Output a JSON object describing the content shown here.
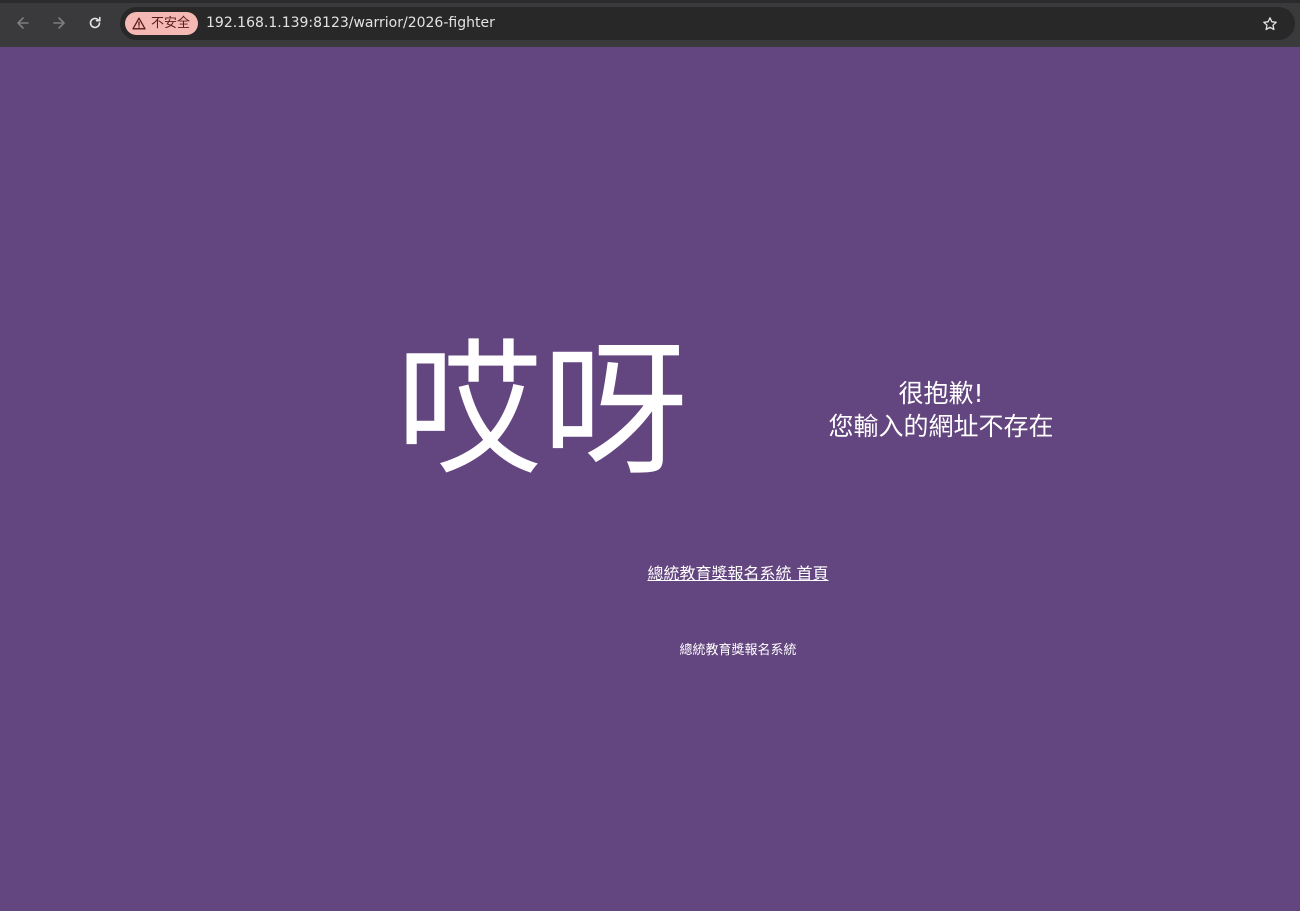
{
  "browser": {
    "security_label": "不安全",
    "url": "192.168.1.139:8123/warrior/2026-fighter",
    "icons": {
      "back": "back-arrow-icon",
      "forward": "forward-arrow-icon",
      "reload": "reload-icon",
      "warning": "warning-triangle-icon",
      "bookmark": "star-icon"
    },
    "colors": {
      "toolbar": "#3a3a3c",
      "omnibox": "#282828",
      "security_chip": "#f4b9b5"
    }
  },
  "page": {
    "background": "#63457f",
    "headline": "哎呀",
    "sorry_line1": "很抱歉!",
    "sorry_line2": "您輸入的網址不存在",
    "home_link": "總統教育獎報名系統 首頁",
    "footer": "總統教育獎報名系統"
  }
}
